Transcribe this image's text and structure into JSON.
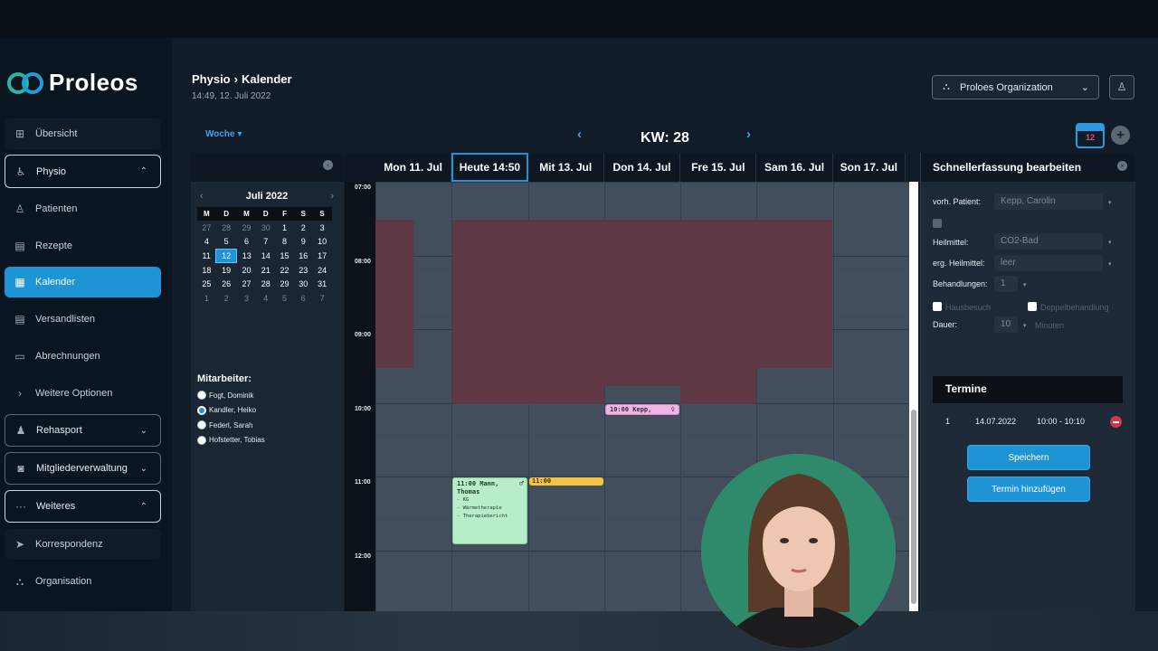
{
  "app": {
    "brand": "Proleos"
  },
  "sidebar": {
    "items": [
      {
        "label": "Übersicht",
        "icon": "grid-icon"
      },
      {
        "label": "Physio",
        "icon": "physio-icon",
        "expanded": true
      },
      {
        "label": "Patienten",
        "icon": "user-icon"
      },
      {
        "label": "Rezepte",
        "icon": "clipboard-icon"
      },
      {
        "label": "Kalender",
        "icon": "calendar-icon",
        "active": true
      },
      {
        "label": "Versandlisten",
        "icon": "list-icon"
      },
      {
        "label": "Abrechnungen",
        "icon": "card-icon"
      },
      {
        "label": "Weitere Optionen",
        "icon": "chevron-right-icon"
      },
      {
        "label": "Rehasport",
        "icon": "walk-icon"
      },
      {
        "label": "Mitgliederverwaltung",
        "icon": "watch-icon"
      },
      {
        "label": "Weiteres",
        "icon": "more-icon",
        "expanded": true
      },
      {
        "label": "Korrespondenz",
        "icon": "send-icon"
      },
      {
        "label": "Organisation",
        "icon": "org-icon"
      }
    ]
  },
  "header": {
    "breadcrumb_root": "Physio",
    "breadcrumb_page": "Kalender",
    "datetime": "14:49, 12. Juli 2022",
    "org_select": "Proloes Organization"
  },
  "toolbar": {
    "view_select": "Woche",
    "week_label": "KW: 28",
    "calendar_badge": "12"
  },
  "mini_calendar": {
    "month": "Juli 2022",
    "weekdays": [
      "M",
      "D",
      "M",
      "D",
      "F",
      "S",
      "S"
    ],
    "weeks": [
      [
        "27",
        "28",
        "29",
        "30",
        "1",
        "2",
        "3"
      ],
      [
        "4",
        "5",
        "6",
        "7",
        "8",
        "9",
        "10"
      ],
      [
        "11",
        "12",
        "13",
        "14",
        "15",
        "16",
        "17"
      ],
      [
        "18",
        "19",
        "20",
        "21",
        "22",
        "23",
        "24"
      ],
      [
        "25",
        "26",
        "27",
        "28",
        "29",
        "30",
        "31"
      ],
      [
        "1",
        "2",
        "3",
        "4",
        "5",
        "6",
        "7"
      ]
    ],
    "today": "12"
  },
  "staff": {
    "title": "Mitarbeiter:",
    "members": [
      "Fogt, Dominik",
      "Kandler, Heiko",
      "Federl, Sarah",
      "Hofstetter, Tobias"
    ],
    "selected": "Kandler, Heiko"
  },
  "calendar": {
    "days": [
      "Mon 11. Jul",
      "Heute 14:50",
      "Mit 13. Jul",
      "Don 14. Jul",
      "Fre 15. Jul",
      "Sam 16. Jul",
      "Son 17. Jul"
    ],
    "today_index": 1,
    "hours": [
      "07:00",
      "08:00",
      "09:00",
      "10:00",
      "11:00",
      "12:00"
    ],
    "events": [
      {
        "day": "Don 14. Jul",
        "title": "10:00 Kepp,",
        "symbol": "♀",
        "color": "#f2b4e6"
      },
      {
        "day": "Heute 14:50",
        "title": "11:00 Mann, Thomas",
        "symbol": "♂",
        "lines": [
          "- KG",
          "- Wärmetherapie",
          "- Therapiebericht"
        ],
        "color": "#b7edc8"
      },
      {
        "day": "Mit 13. Jul",
        "title": "11:00",
        "color": "#f3c441"
      }
    ]
  },
  "quick_edit": {
    "title": "Schnellerfassung bearbeiten",
    "patient_label": "vorh. Patient:",
    "patient_value": "Kepp, Carolin",
    "heilmittel_label": "Heilmittel:",
    "heilmittel_value": "CO2-Bad",
    "erg_label": "erg. Heilmittel:",
    "erg_value": "leer",
    "behandlungen_label": "Behandlungen:",
    "behandlungen_value": "1",
    "hausbesuch_label": "Hausbesuch",
    "doppel_label": "Doppelbehandlung",
    "dauer_label": "Dauer:",
    "dauer_value": "10",
    "dauer_unit": "Minuten",
    "termine_title": "Termine",
    "termine": [
      {
        "nr": "1",
        "date": "14.07.2022",
        "time": "10:00 - 10:10"
      }
    ],
    "save_label": "Speichern",
    "add_label": "Termin hinzufügen"
  }
}
